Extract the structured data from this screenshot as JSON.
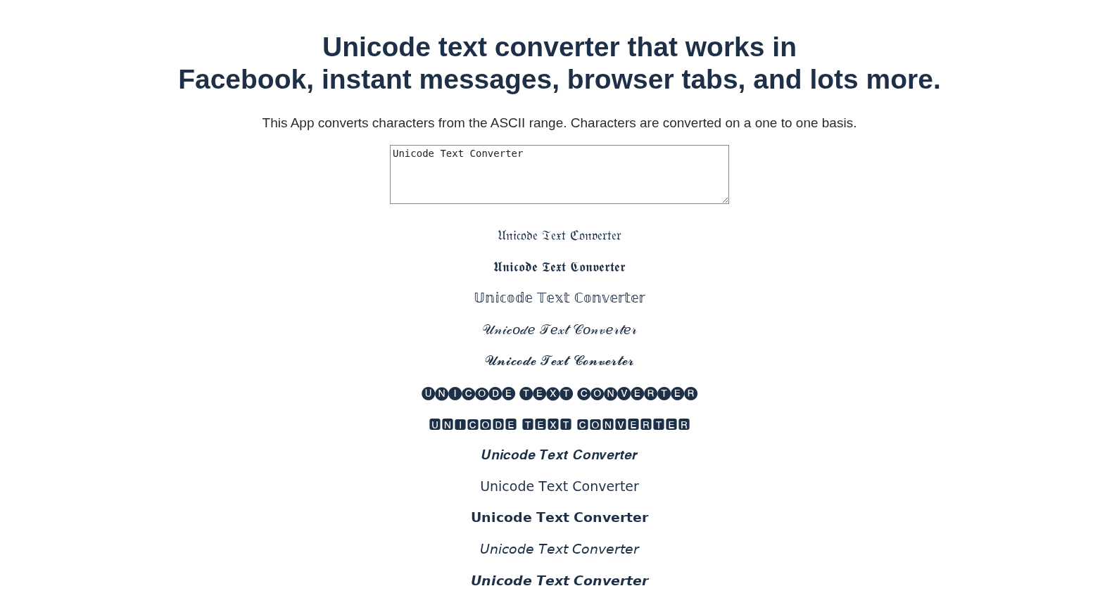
{
  "heading": {
    "lines": [
      "Unicode text converter that works in",
      "Facebook, instant messages, browser tabs, and lots more."
    ]
  },
  "intro": "This App converts characters from the ASCII range. Characters are converted on a one to one basis.",
  "input": {
    "value": "Unicode Text Converter"
  },
  "outputs": [
    {
      "text": "𝔘𝔫𝔦𝔠𝔬𝔡𝔢 𝔗𝔢𝔵𝔱 ℭ𝔬𝔫𝔳𝔢𝔯𝔱𝔢𝔯"
    },
    {
      "text": "𝖀𝖓𝖎𝖈𝖔𝖉𝖊 𝕿𝖊𝖝𝖙 𝕮𝖔𝖓𝖛𝖊𝖗𝖙𝖊𝖗"
    },
    {
      "text": "𝕌𝕟𝕚𝕔𝕠𝕕𝕖 𝕋𝕖𝕩𝕥 ℂ𝕠𝕟𝕧𝕖𝕣𝕥𝕖𝕣"
    },
    {
      "text": "𝒰𝓃𝒾𝒸𝑜𝒹𝑒 𝒯𝑒𝓍𝓉 𝒞𝑜𝓃𝓋𝑒𝓇𝓉𝑒𝓇"
    },
    {
      "text": "𝓤𝓷𝓲𝓬𝓸𝓭𝓮 𝓣𝓮𝔁𝓽 𝓒𝓸𝓷𝓿𝓮𝓻𝓽𝓮𝓻"
    },
    {
      "text": "🅤🅝🅘🅒🅞🅓🅔 🅣🅔🅧🅣 🅒🅞🅝🅥🅔🅡🅣🅔🅡"
    },
    {
      "text": "🆄🅽🅸🅲🅾🅳🅴 🆃🅴🆇🆃 🅲🅾🅽🆅🅴🆁🆃🅴🆁"
    },
    {
      "text": "𝑼𝒏𝒊𝒄𝒐𝒅𝒆 𝑻𝒆𝒙𝒕 𝑪𝒐𝒏𝒗𝒆𝒓𝒕𝒆𝒓"
    },
    {
      "text": "𝖴𝗇𝗂𝖼𝗈𝖽𝖾 𝖳𝖾𝗑𝗍 𝖢𝗈𝗇𝗏𝖾𝗋𝗍𝖾𝗋"
    },
    {
      "text": "𝗨𝗻𝗶𝗰𝗼𝗱𝗲 𝗧𝗲𝘅𝘁 𝗖𝗼𝗻𝘃𝗲𝗿𝘁𝗲𝗿"
    },
    {
      "text": "𝘜𝘯𝘪𝘤𝘰𝘥𝘦 𝘛𝘦𝘹𝘵 𝘊𝘰𝘯𝘷𝘦𝘳𝘵𝘦𝘳"
    },
    {
      "text": "𝙐𝙣𝙞𝙘𝙤𝙙𝙚 𝙏𝙚𝙭𝙩 𝘾𝙤𝙣𝙫𝙚𝙧𝙩𝙚𝙧"
    }
  ]
}
